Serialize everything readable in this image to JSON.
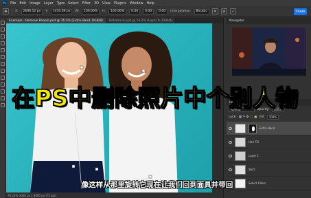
{
  "app": {
    "logo": "Ps"
  },
  "menu": [
    "File",
    "Edit",
    "Image",
    "Layer",
    "Type",
    "Select",
    "Filter",
    "3D",
    "View",
    "Plugins",
    "Window",
    "Help"
  ],
  "options": {
    "x_label": "X:",
    "x_value": "2696.52 px",
    "y_label": "Y:",
    "y_value": "1410.09 px",
    "w_label": "W:",
    "w_value": "100.00%",
    "h_label": "H:",
    "h_value": "100.00%",
    "angle_value": "0.00",
    "h2_value": "0.00",
    "v_value": "0.00",
    "interp_label": "Interpolation:",
    "interp_value": "Bicubic",
    "share_label": "Share"
  },
  "tabs": [
    {
      "label": "Example - Remove People.psd @ 76.3% (Extra Hand, RGB/8)"
    },
    {
      "label": "Reference.psd @ 74.2% (Layer 9, RGB/8)"
    }
  ],
  "status": {
    "text": "76.23%   3000 px x 4000 px (72 ppi)"
  },
  "navigator": {
    "title": "Navigator"
  },
  "layers": {
    "title": "Layers",
    "blend_mode": "Normal",
    "opacity_label": "Opacity:",
    "opacity_value": "100%",
    "lock_label": "Lock:",
    "fill_label": "Fill:",
    "fill_value": "100%",
    "items": [
      {
        "name": "Extra Hand"
      },
      {
        "name": "Hair Fill"
      },
      {
        "name": "Layer 1"
      },
      {
        "name": "Shirt"
      },
      {
        "name": "Select Fillers"
      }
    ]
  },
  "overlay": {
    "title": "在PS中删除照片中个别人物",
    "subtitle": "像这样从那里旋转它现在让我们回到面具并带回"
  },
  "colors": {
    "accent": "#1473e6",
    "title_yellow": "#f5e600",
    "canvas_bg": "#2fb7c0"
  }
}
